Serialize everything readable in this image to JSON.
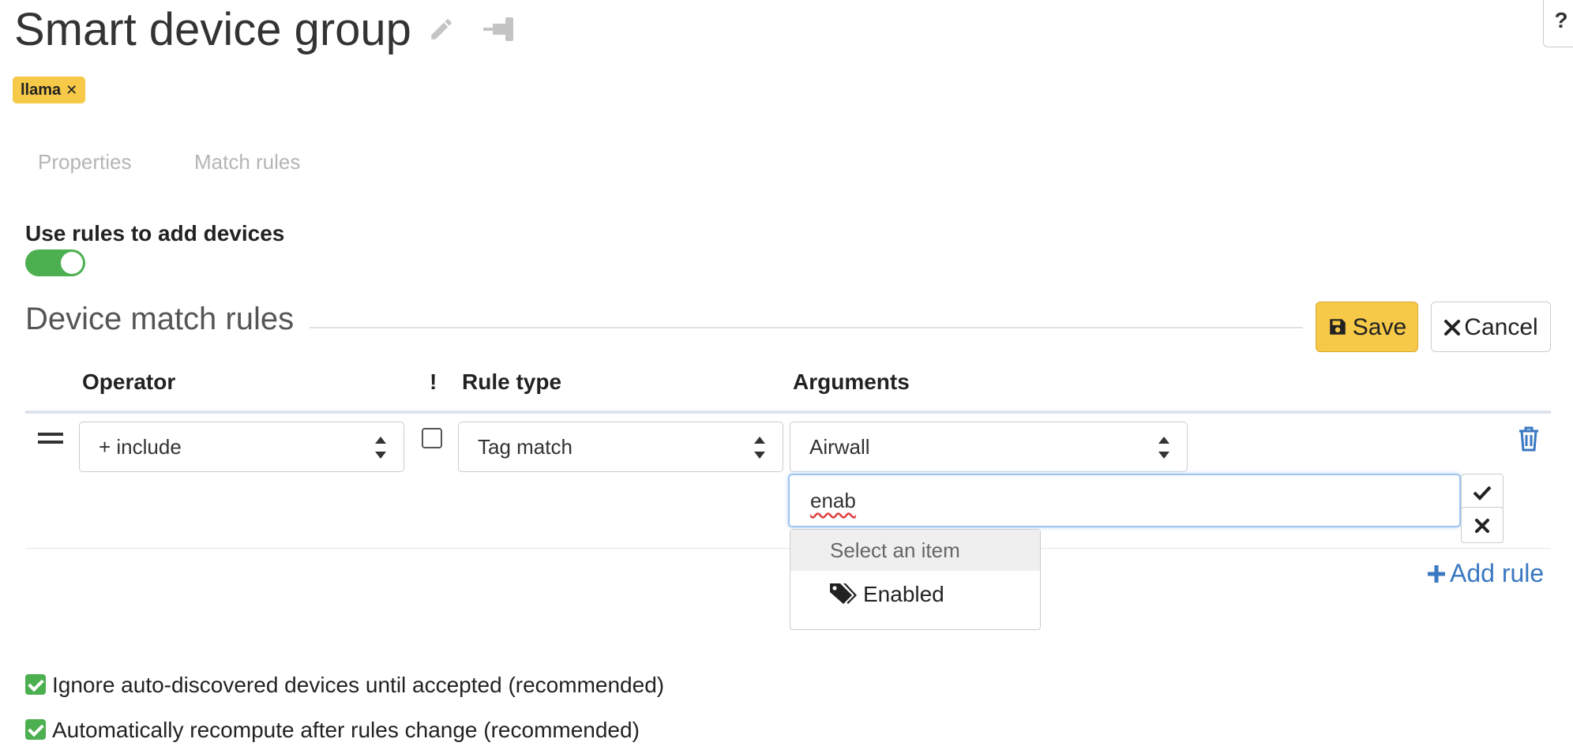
{
  "header": {
    "title": "Smart device group",
    "help_label": "?"
  },
  "tags": [
    {
      "label": "llama",
      "remove_symbol": "✕"
    }
  ],
  "tabs": [
    {
      "label": "Properties"
    },
    {
      "label": "Match rules"
    }
  ],
  "rules_toggle": {
    "label": "Use rules to add devices",
    "enabled": true
  },
  "match_rules": {
    "heading": "Device match rules",
    "save_label": "Save",
    "cancel_label": "Cancel",
    "columns": {
      "operator": "Operator",
      "negate": "!",
      "rule_type": "Rule type",
      "arguments": "Arguments"
    },
    "rows": [
      {
        "operator": "+ include",
        "negate": false,
        "rule_type": "Tag match",
        "argument": "Airwall",
        "search_value": "enab",
        "dropdown_placeholder": "Select an item",
        "dropdown_options": [
          "Enabled"
        ]
      }
    ],
    "add_rule_label": "Add rule"
  },
  "options": [
    {
      "label": "Ignore auto-discovered devices until accepted (recommended)",
      "checked": true
    },
    {
      "label": "Automatically recompute after rules change (recommended)",
      "checked": true
    }
  ],
  "colors": {
    "accent_yellow": "#f7c948",
    "link_blue": "#3a78c2",
    "toggle_green": "#4caf50"
  }
}
